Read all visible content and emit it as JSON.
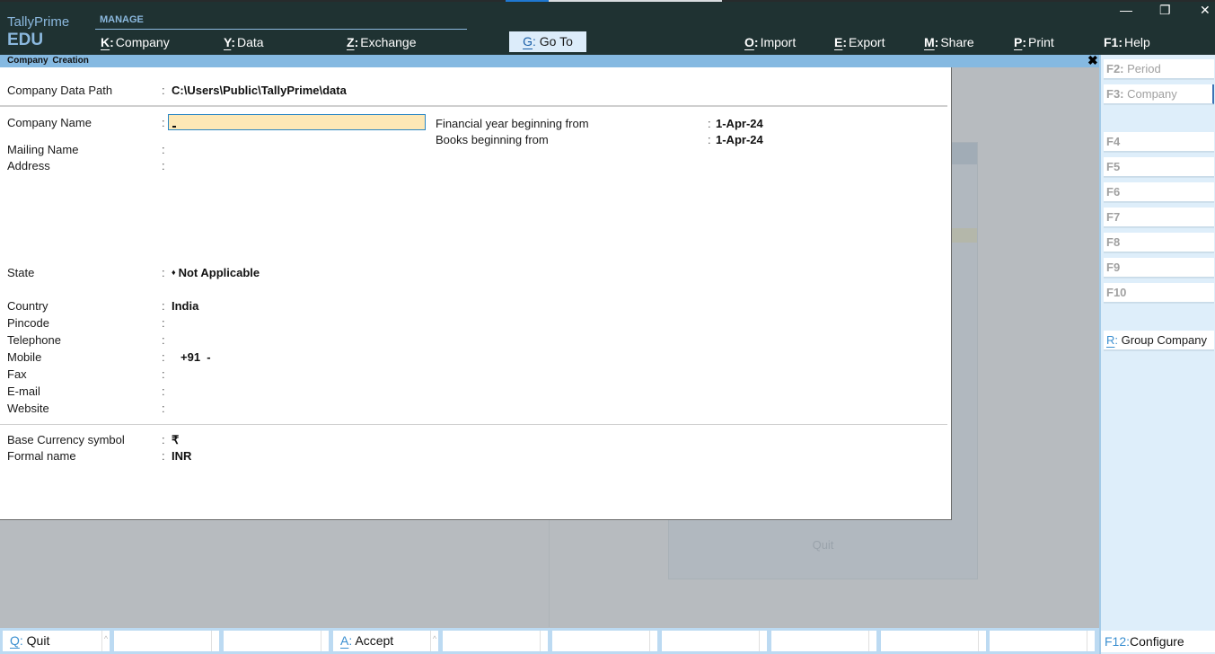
{
  "app": {
    "brand_line1": "TallyPrime",
    "brand_line2": "EDU",
    "section": "MANAGE"
  },
  "menu": [
    {
      "key": "K",
      "label": "Company"
    },
    {
      "key": "Y",
      "label": "Data"
    },
    {
      "key": "Z",
      "label": "Exchange"
    },
    {
      "key": "G",
      "label": "Go To"
    },
    {
      "key": "O",
      "label": "Import"
    },
    {
      "key": "E",
      "label": "Export"
    },
    {
      "key": "M",
      "label": "Share"
    },
    {
      "key": "P",
      "label": "Print"
    },
    {
      "key": "F1",
      "label": "Help"
    }
  ],
  "window_controls": {
    "minimize": "—",
    "restore": "❐",
    "close": "✕"
  },
  "screen": {
    "title": "Company Creation",
    "close": "✖"
  },
  "form": {
    "data_path": {
      "label": "Company Data Path",
      "value": "C:\\Users\\Public\\TallyPrime\\data"
    },
    "company_name": {
      "label": "Company Name",
      "value": ""
    },
    "mailing_name": {
      "label": "Mailing Name",
      "value": ""
    },
    "address": {
      "label": "Address",
      "value": ""
    },
    "state": {
      "label": "State",
      "value": "Not Applicable",
      "marker": "♦"
    },
    "country": {
      "label": "Country",
      "value": "India"
    },
    "pincode": {
      "label": "Pincode",
      "value": ""
    },
    "telephone": {
      "label": "Telephone",
      "value": ""
    },
    "mobile": {
      "label": "Mobile",
      "value": "+91  -"
    },
    "fax": {
      "label": "Fax",
      "value": ""
    },
    "email": {
      "label": "E-mail",
      "value": ""
    },
    "website": {
      "label": "Website",
      "value": ""
    },
    "currency_symbol": {
      "label": "Base Currency symbol",
      "value": "₹"
    },
    "formal_name": {
      "label": "Formal name",
      "value": "INR"
    },
    "fy_begin": {
      "label": "Financial year beginning from",
      "value": "1-Apr-24"
    },
    "books_begin": {
      "label": "Books beginning from",
      "value": "1-Apr-24"
    },
    "separator": ":"
  },
  "background": {
    "ghost_quit": "Quit"
  },
  "right_bar": {
    "f2": {
      "key": "F2:",
      "label": "Period"
    },
    "f3": {
      "key": "F3:",
      "label": "Company"
    },
    "f4": "F4",
    "f5": "F5",
    "f6": "F6",
    "f7": "F7",
    "f8": "F8",
    "f9": "F9",
    "f10": "F10",
    "group": {
      "key": "R",
      "label": "Group Company"
    }
  },
  "bottom_bar": {
    "quit": {
      "key": "Q",
      "label": "Quit"
    },
    "accept": {
      "key": "A",
      "label": "Accept"
    },
    "caret": "^",
    "configure": {
      "key": "F12:",
      "label": "Configure"
    }
  }
}
